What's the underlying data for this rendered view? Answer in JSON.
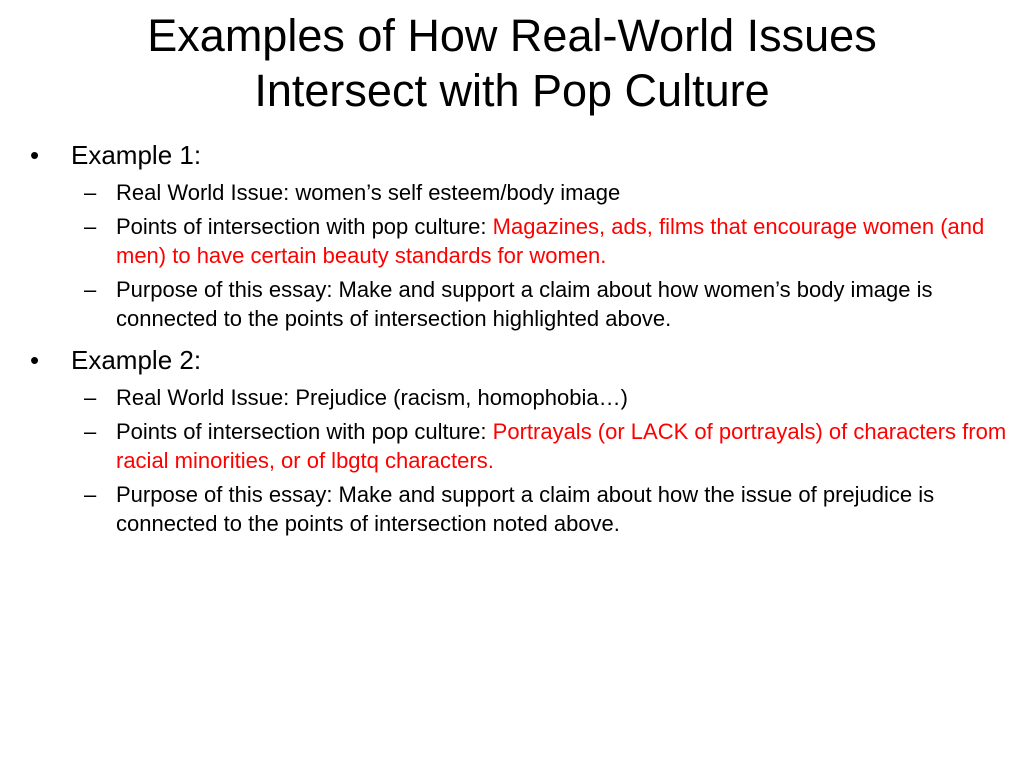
{
  "title": "Examples of How Real-World Issues Intersect with Pop Culture",
  "colors": {
    "text": "#000000",
    "highlight": "#ff0000",
    "background": "#ffffff"
  },
  "bullet_glyph": "•",
  "dash_glyph": "–",
  "examples": [
    {
      "heading": "Example 1:",
      "items": [
        {
          "text": "Real World Issue: women’s self esteem/body image",
          "highlight": ""
        },
        {
          "text": "Points of intersection with pop culture: ",
          "highlight": "Magazines, ads, films that encourage women (and men) to have certain beauty standards for women."
        },
        {
          "text": "Purpose of this essay: Make and support a claim about how women’s body image is connected to the points of intersection highlighted above.",
          "highlight": ""
        }
      ]
    },
    {
      "heading": "Example 2:",
      "items": [
        {
          "text": "Real World Issue: Prejudice (racism, homophobia…)",
          "highlight": ""
        },
        {
          "text": "Points of intersection with pop culture:  ",
          "highlight": "Portrayals (or LACK of portrayals) of characters from racial minorities, or of lbgtq characters."
        },
        {
          "text": "Purpose of this essay: Make and support a claim about how the issue of prejudice is connected to the points of intersection noted above.",
          "highlight": ""
        }
      ]
    }
  ]
}
